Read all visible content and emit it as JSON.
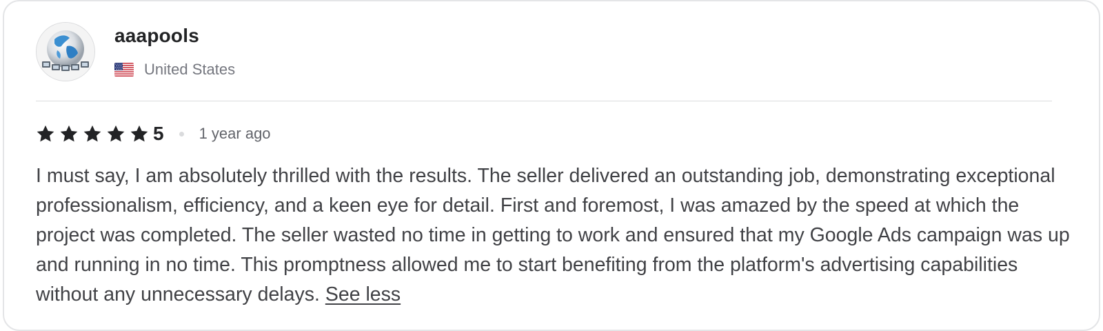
{
  "review": {
    "username": "aaapools",
    "country": "United States",
    "country_flag_icon": "us-flag-icon",
    "avatar_icon": "globe-network-avatar",
    "rating": "5",
    "rating_stars": 5,
    "time_ago": "1 year ago",
    "text": "I must say, I am absolutely thrilled with the results. The seller delivered an outstanding job, demonstrating exceptional professionalism, efficiency, and a keen eye for detail. First and foremost, I was amazed by the speed at which the project was completed. The seller wasted no time in getting to work and ensured that my Google Ads campaign was up and running in no time. This promptness allowed me to start benefiting from the platform's advertising capabilities without any unnecessary delays.",
    "toggle_label": "See less"
  },
  "colors": {
    "star": "#222325",
    "text": "#404145",
    "muted": "#74767e",
    "border": "#e4e5e7"
  }
}
